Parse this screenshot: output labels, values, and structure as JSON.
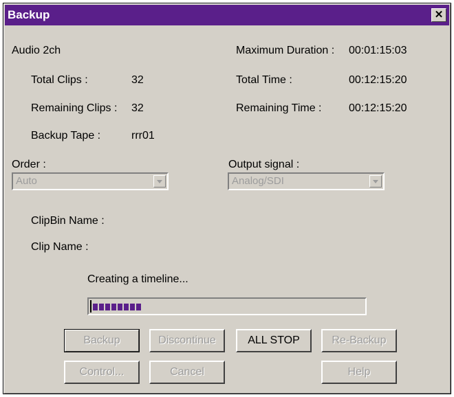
{
  "window": {
    "title": "Backup",
    "close_glyph": "✕"
  },
  "info": {
    "audio": "Audio 2ch",
    "max_duration_label": "Maximum Duration :",
    "max_duration_value": "00:01:15:03",
    "total_clips_label": "Total Clips :",
    "total_clips_value": "32",
    "total_time_label": "Total Time :",
    "total_time_value": "00:12:15:20",
    "remaining_clips_label": "Remaining Clips :",
    "remaining_clips_value": "32",
    "remaining_time_label": "Remaining Time :",
    "remaining_time_value": "00:12:15:20",
    "backup_tape_label": "Backup Tape :",
    "backup_tape_value": "rrr01"
  },
  "order": {
    "label": "Order :",
    "value": "Auto"
  },
  "output_signal": {
    "label": "Output signal :",
    "value": "Analog/SDI"
  },
  "clipbin_label": "ClipBin Name :",
  "clip_label": "Clip Name :",
  "status_text": "Creating a timeline...",
  "progress": {
    "segments": 8,
    "segment_color": "#5a1f8a"
  },
  "buttons": {
    "backup": "Backup",
    "discontinue": "Discontinue",
    "all_stop": "ALL STOP",
    "re_backup": "Re-Backup",
    "control": "Control...",
    "cancel": "Cancel",
    "help": "Help"
  }
}
